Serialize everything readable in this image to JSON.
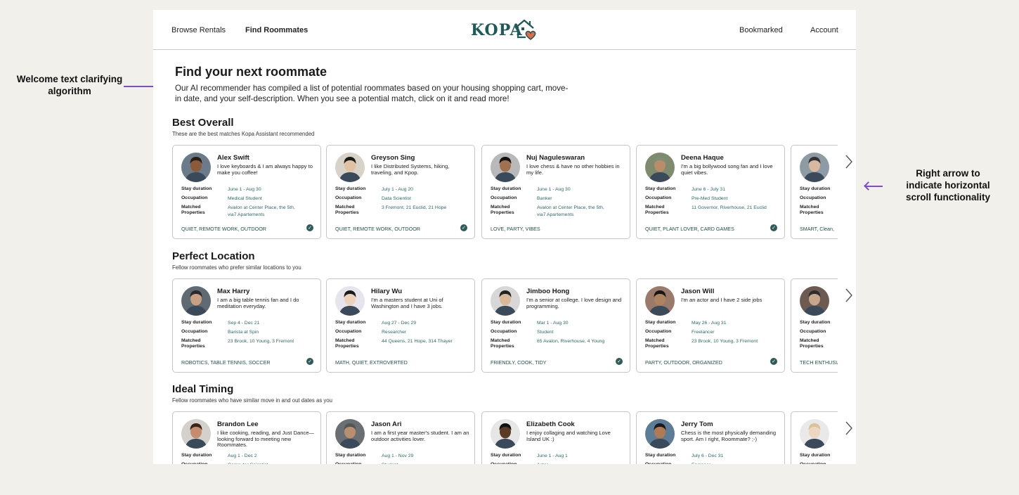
{
  "annotations": {
    "welcome": "Welcome text clarifying algorithm",
    "arrow": "Right arrow to indicate horizontal scroll functionality"
  },
  "nav": {
    "browse": "Browse Rentals",
    "find": "Find Roommates",
    "logo": "KOPA",
    "bookmarked": "Bookmarked",
    "account": "Account"
  },
  "hero": {
    "title": "Find your next roommate",
    "text": "Our AI recommender has compiled a list of potential roommates based on your housing shopping cart, move-in date, and your self-description. When you see a potential match, click on it and read more!"
  },
  "labels": {
    "stay": "Stay duration",
    "occupation": "Occupation",
    "matched": "Matched Properties"
  },
  "colors": {
    "teal": "#1f5a57",
    "heart": "#e06a4b",
    "accent": "#7b4fc9"
  },
  "sections": [
    {
      "title": "Best Overall",
      "subtitle": "These are the best matches Kopa Assistant recommended",
      "cards": [
        {
          "name": "Alex Swift",
          "bio": "I love keyboards & I am always happy to make you coffee!",
          "stay": "June 1 - Aug 30",
          "occupation": "Medical Student",
          "matched": "Avalon at Center Place, the 5th, via7 Apartements",
          "tags": "QUIET, REMOTE WORK, OUTDOOR",
          "verified": true,
          "skin": "#8a5a3c",
          "hair": "#2b1d14",
          "bg": "#6b7b8a"
        },
        {
          "name": "Greyson Sing",
          "bio": "I like Distributed Systems, hiking, traveling, and Kpop.",
          "stay": "July 1 - Aug 20",
          "occupation": "Data Scientist",
          "matched": "3 Fremont, 21 Euclid, 21 Hope",
          "tags": "QUIET, REMOTE WORK, OUTDOOR",
          "verified": true,
          "skin": "#e0c2a2",
          "hair": "#1a1a1a",
          "bg": "#d8d2c8"
        },
        {
          "name": "Nuj Naguleswaran",
          "bio": "I love chess & have no other hobbies in my life.",
          "stay": "June 1 - Aug 30",
          "occupation": "Banker",
          "matched": "Avalon at Center Place, the 5th, via7 Apartements",
          "tags": "LOVE, PARTY, VIBES",
          "verified": false,
          "skin": "#a0714e",
          "hair": "#111111",
          "bg": "#b9b9b9"
        },
        {
          "name": "Deena Haque",
          "bio": "I'm a big bollywood song fan and I love quiet vibes.",
          "stay": "June 6 - July 31",
          "occupation": "Pre-Med Student",
          "matched": "11 Governor, Riverhouse, 21 Euclid",
          "tags": "QUIET, PLANT LOVER, CARD GAMES",
          "verified": true,
          "skin": "#b98c6a",
          "hair": "#7d8f78",
          "bg": "#7f8b6e"
        },
        {
          "name": "",
          "bio": "",
          "stay": "",
          "occupation": "",
          "matched": "",
          "tags": "SMART, Clean,",
          "verified": false,
          "skin": "#d6b9a0",
          "hair": "#333333",
          "bg": "#8e9aa4"
        }
      ]
    },
    {
      "title": "Perfect Location",
      "subtitle": "Fellow roommates who prefer similar locations to you",
      "cards": [
        {
          "name": "Max Harry",
          "bio": "I am a big table tennis fan and I do meditation everyday.",
          "stay": "Sep 4 - Dec 21",
          "occupation": "Barista at Spin",
          "matched": "23 Brook, 10 Young, 3 Fremont",
          "tags": "ROBOTICS, TABLE TENNIS, SOCCER",
          "verified": true,
          "skin": "#caa083",
          "hair": "#2a2a2a",
          "bg": "#5f6a72"
        },
        {
          "name": "Hilary Wu",
          "bio": "I'm a masters student at Uni of Washington and I have 3 jobs.",
          "stay": "Aug 27 - Dec 29",
          "occupation": "Researcher",
          "matched": "44 Queens, 21 Hope, 314 Thayer",
          "tags": "MATH, QUIET, EXTROVERTED",
          "verified": false,
          "skin": "#ecd2bb",
          "hair": "#1a1a1a",
          "bg": "#e8e4ee"
        },
        {
          "name": "Jimboo Hong",
          "bio": "I'm a senior at college. I love design and programming.",
          "stay": "Mar 1 - Aug 30",
          "occupation": "Student",
          "matched": "65 Avalon, Riverhouse, 4 Young",
          "tags": "FRIENDLY, COOK, TIDY",
          "verified": true,
          "skin": "#d9b89a",
          "hair": "#222222",
          "bg": "#d7d7d7"
        },
        {
          "name": "Jason Will",
          "bio": "I'm an actor and I have 2 side jobs",
          "stay": "May 26 - Aug 31",
          "occupation": "Freelancer",
          "matched": "23 Brook, 10 Young, 3 Fremont",
          "tags": "PARTY, OUTDOOR, ORGANIZED",
          "verified": true,
          "skin": "#b08360",
          "hair": "#161616",
          "bg": "#9a7a6a"
        },
        {
          "name": "",
          "bio": "",
          "stay": "",
          "occupation": "",
          "matched": "",
          "tags": "TECH ENTHUSIA",
          "verified": false,
          "skin": "#c8a68c",
          "hair": "#2d2d2d",
          "bg": "#6d5a52"
        }
      ]
    },
    {
      "title": "Ideal Timing",
      "subtitle": "Fellow roommates who have similar move in and out dates as you",
      "cards": [
        {
          "name": "Brandon Lee",
          "bio": "I like cooking, reading, and Just Dance—looking forward to meeting new Roommates.",
          "stay": "Aug 1 - Dec 2",
          "occupation": "Computer Scientist",
          "matched": "",
          "tags": "",
          "verified": false,
          "skin": "#c48e6e",
          "hair": "#3a2418",
          "bg": "#d4d0cb"
        },
        {
          "name": "Jason Ari",
          "bio": "I am a first year master's student. I am an outdoor activities lover.",
          "stay": "Aug 1 - Nov 29",
          "occupation": "Student",
          "matched": "",
          "tags": "",
          "verified": false,
          "skin": "#b98f70",
          "hair": "#555555",
          "bg": "#6a6f74"
        },
        {
          "name": "Elizabeth Cook",
          "bio": "I enjoy collaging and watching Love Island UK :)",
          "stay": "June 1 - Aug 1",
          "occupation": "Actor",
          "matched": "",
          "tags": "",
          "verified": false,
          "skin": "#5a3b26",
          "hair": "#111111",
          "bg": "#e6e6e6"
        },
        {
          "name": "Jerry Tom",
          "bio": "Chess is the most physically demanding sport. Am I right, Roommate? ;-)",
          "stay": "July 6 - Dec 31",
          "occupation": "Engineer",
          "matched": "",
          "tags": "",
          "verified": false,
          "skin": "#b07a55",
          "hair": "#1b1b1b",
          "bg": "#5d7c95"
        },
        {
          "name": "",
          "bio": "",
          "stay": "",
          "occupation": "",
          "matched": "",
          "tags": "",
          "verified": false,
          "skin": "#eed6c1",
          "hair": "#d9c39a",
          "bg": "#e9e9e9"
        }
      ]
    }
  ]
}
